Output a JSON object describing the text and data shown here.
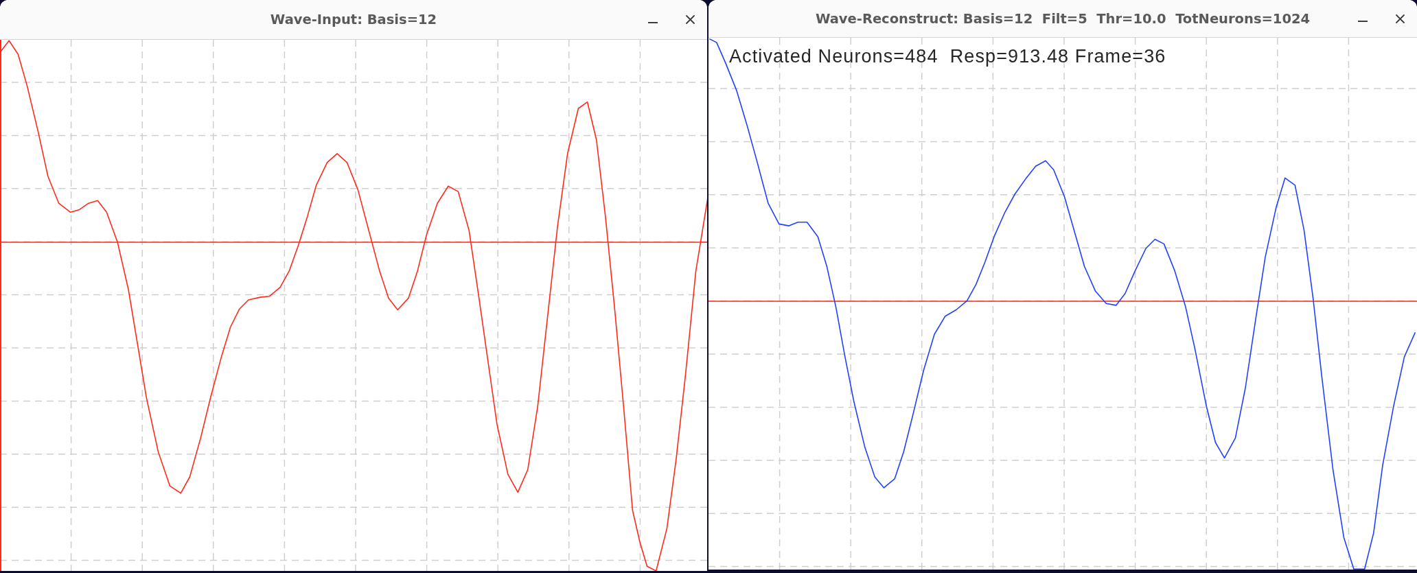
{
  "windows": [
    {
      "title": "Wave-Input: Basis=12",
      "color": "#ff2a1a"
    },
    {
      "title": "Wave-Reconstruct: Basis=12  Filt=5  Thr=10.0  TotNeurons=1024",
      "overlay_text": "Activated Neurons=484  Resp=913.48 Frame=36",
      "color": "#2040ff"
    }
  ]
}
